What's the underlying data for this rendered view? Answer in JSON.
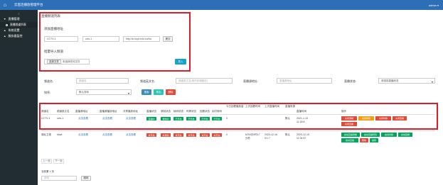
{
  "topbar": {
    "title": "云直连播放管理平台",
    "user": "admin ▾"
  },
  "sidebar": {
    "collapse": "≡",
    "items": [
      {
        "label": "直播管理",
        "caret": "▼"
      },
      {
        "label": "直播频道列表",
        "sub": true,
        "active": true
      },
      {
        "label": "系统设置",
        "caret": "▲"
      },
      {
        "label": "服务器监控",
        "caret": "▲"
      }
    ]
  },
  "panel": {
    "title": "直播频道列表"
  },
  "add": {
    "title": "添加直播地址",
    "name_value": "CCTV-1",
    "code_value": "cctv-1",
    "url_value": "http://ic.bupt.edu.cn/hls",
    "submit": "提交"
  },
  "batch": {
    "title": "批量导入频道",
    "file_button": "选择文件",
    "file_status": "未选择任何文件",
    "import": "导入"
  },
  "filters": {
    "name_label": "频道名:",
    "name_placeholder": "频道名",
    "file_label": "频道英文名:",
    "file_placeholder": "频道英文名(用作存储路径)",
    "source_label": "直播源地址:",
    "source_placeholder": "直播源地址",
    "status_label": "直播状态:",
    "status_value": "请选择直播状态",
    "sort_label": "排序:",
    "sort_value": "默认排序",
    "search": "搜索",
    "export": "导出",
    "delete": "删除"
  },
  "table": {
    "headers": [
      "频道名",
      "频道英文名",
      "直播源地址",
      "直播源播放地址",
      "共享播放地址",
      "直播状态",
      "录制状态",
      "转码状态",
      "时移状态",
      "回看状态",
      "实时转码",
      "今日回看播放量",
      "上次回看时间",
      "上次直播时间",
      "直播来源",
      "直播时间",
      "操作"
    ],
    "rows": [
      {
        "name": "CCTV-1",
        "code": "cctv-1",
        "src": "点击查看",
        "play": "点击查看",
        "share": "点击查看",
        "tags": [
          "直播中",
          "录制中",
          "已开启",
          "已开启",
          "已开启",
          "已开启"
        ],
        "views": "0",
        "last_review": "",
        "last_live": "",
        "source": "默认",
        "time": "2021-1-13 11:18:6",
        "actions": [
          "关闭录制",
          "关闭转码",
          "关闭时移",
          "关闭回看",
          "关闭直播"
        ]
      },
      {
        "name": "湖北卫视",
        "code": "hbwt",
        "src": "点击查看",
        "play": "点击查看",
        "share": "点击查看",
        "tags": [
          "未开启",
          "未录制",
          "未开启",
          "未开启",
          "未开启",
          "未开启"
        ],
        "views": "0",
        "last_review": "6200天9时17分秒",
        "last_live": "2020-12-16 9:1:7",
        "source": "默认",
        "time": "2020-12-15 11:34:57",
        "actions": [
          "启动直播录制",
          "启动直播转码",
          "启动时移",
          "启动回看",
          "启动直播",
          "删除",
          "编辑"
        ]
      }
    ]
  },
  "pagination": {
    "prev": "上一页",
    "next": "下一页",
    "total": "当前第 1 页",
    "jump_placeholder": "页码",
    "jump": "跳转"
  },
  "colors": {
    "topbar": "#2c6fb7",
    "sidebar": "#222d32",
    "highlight": "#e01b2a"
  }
}
